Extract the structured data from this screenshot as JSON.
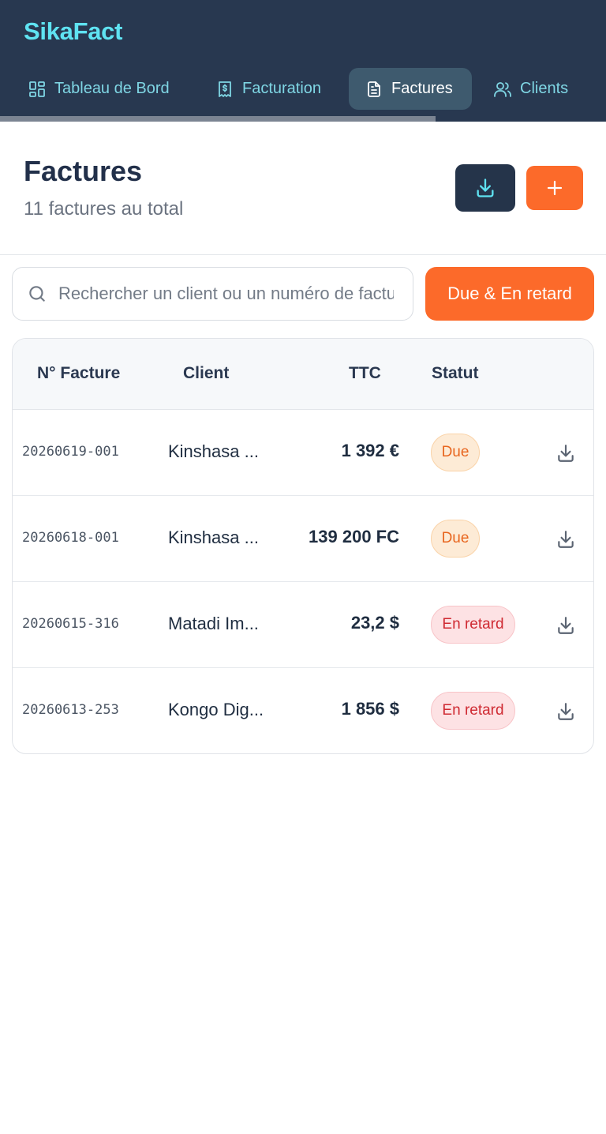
{
  "app": {
    "brand": "SikaFact"
  },
  "nav": {
    "items": [
      {
        "label": "Tableau de Bord",
        "icon": "dashboard-icon"
      },
      {
        "label": "Facturation",
        "icon": "receipt-icon"
      },
      {
        "label": "Factures",
        "icon": "document-icon",
        "active": true
      },
      {
        "label": "Clients",
        "icon": "users-icon"
      }
    ]
  },
  "page": {
    "title": "Factures",
    "subtitle": "11 factures au total"
  },
  "search": {
    "placeholder": "Rechercher un client ou un numéro de facture"
  },
  "filter": {
    "label": "Due & En retard"
  },
  "table": {
    "headers": {
      "number": "N° Facture",
      "client": "Client",
      "ttc": "TTC",
      "status": "Statut"
    },
    "rows": [
      {
        "number": "20260619-001",
        "client": "Kinshasa ...",
        "ttc": "1 392 €",
        "status": "Due"
      },
      {
        "number": "20260618-001",
        "client": "Kinshasa ...",
        "ttc": "139 200 FC",
        "status": "Due"
      },
      {
        "number": "20260615-316",
        "client": "Matadi Im...",
        "ttc": "23,2 $",
        "status": "En retard"
      },
      {
        "number": "20260613-253",
        "client": "Kongo Dig...",
        "ttc": "1 856 $",
        "status": "En retard"
      }
    ]
  },
  "colors": {
    "header_bg": "#283850",
    "brand": "#5fe3f2",
    "accent": "#fc6a2a",
    "due": "#e8661f",
    "late": "#cf2a32"
  }
}
